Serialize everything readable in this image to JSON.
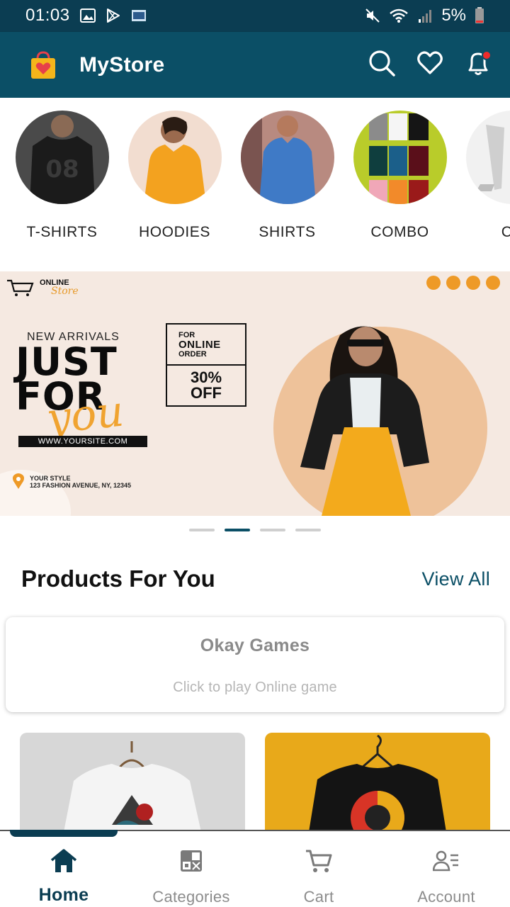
{
  "status_bar": {
    "time": "01:03",
    "battery": "5%",
    "icons": [
      "gallery-icon",
      "play-store-icon",
      "app-icon",
      "mute-icon",
      "wifi-icon",
      "signal-icon",
      "battery-icon"
    ]
  },
  "header": {
    "title": "MyStore",
    "logo_icon": "shopping-bag-heart-icon",
    "actions": [
      "search-icon",
      "heart-icon",
      "bell-icon"
    ],
    "notification_dot_color": "#ef2b2b"
  },
  "categories": [
    {
      "label": "T-SHIRTS"
    },
    {
      "label": "HOODIES"
    },
    {
      "label": "SHIRTS"
    },
    {
      "label": "COMBO"
    },
    {
      "label": "CH"
    }
  ],
  "banner": {
    "brand_line1": "ONLINE",
    "brand_line2": "Store",
    "new_arrivals": "NEW ARRIVALS",
    "headline_1": "JUST",
    "headline_2": "FOR",
    "headline_script": "you",
    "website": "WWW.YOURSITE.COM",
    "offer_for": "FOR",
    "offer_online": "ONLINE",
    "offer_order": "ORDER",
    "offer_percent": "30%",
    "offer_off": "OFF",
    "style_label": "YOUR STYLE",
    "address": "123 FASHION AVENUE, NY, 12345",
    "accent_color": "#ee9a27"
  },
  "carousel": {
    "total": 4,
    "active": 2
  },
  "section": {
    "title": "Products For You",
    "view_all": "View All"
  },
  "game_card": {
    "title": "Okay Games",
    "subtitle": "Click to play Online game"
  },
  "bottom_nav": [
    {
      "label": "Home",
      "icon": "home-icon",
      "active": true
    },
    {
      "label": "Categories",
      "icon": "categories-icon",
      "active": false
    },
    {
      "label": "Cart",
      "icon": "cart-icon",
      "active": false
    },
    {
      "label": "Account",
      "icon": "account-icon",
      "active": false
    }
  ],
  "colors": {
    "primary": "#0b4f66",
    "status_bar": "#0b3d52",
    "accent": "#ef2b2b"
  }
}
